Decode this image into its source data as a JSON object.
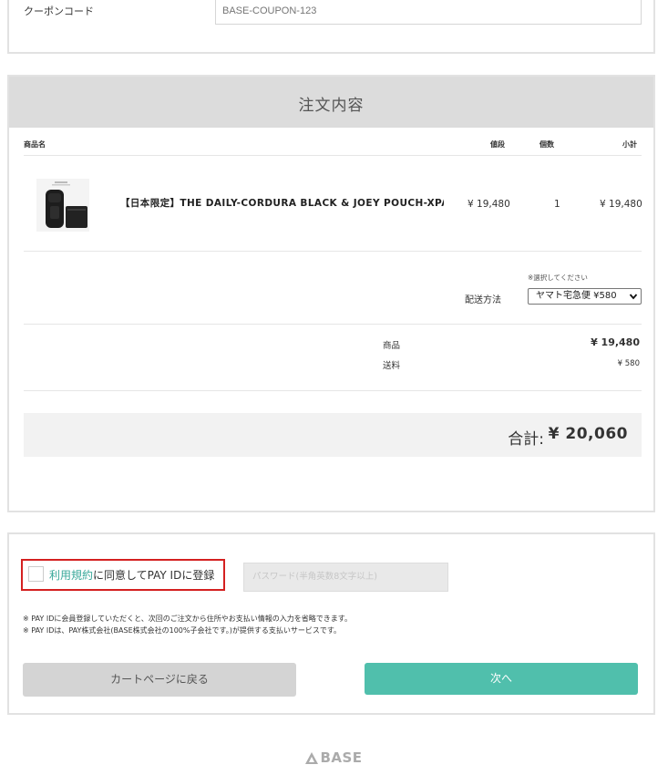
{
  "coupon": {
    "label": "クーポンコード",
    "placeholder": "BASE-COUPON-123"
  },
  "order": {
    "title": "注文内容",
    "columns": {
      "product": "商品名",
      "price": "値段",
      "qty": "個数",
      "subtotal": "小計"
    },
    "item": {
      "name": "【日本限定】THE DAILY-CORDURA BLACK & JOEY POUCH-XPAC",
      "price": "¥ 19,480",
      "qty": "1",
      "subtotal": "¥ 19,480"
    },
    "shipping": {
      "note": "※選択してください",
      "label": "配送方法",
      "selected": "ヤマト宅急便 ¥580"
    },
    "summary": {
      "items_label": "商品",
      "items_value": "¥ 19,480",
      "shipping_label": "送料",
      "shipping_value": "¥ 580"
    },
    "total": {
      "label": "合計:",
      "value": "¥ 20,060"
    }
  },
  "payid": {
    "terms_link": "利用規約",
    "agree_text": "に同意してPAY IDに登録",
    "password_placeholder": "パスワード(半角英数8文字以上)",
    "note1": "※ PAY IDに会員登録していただくと、次回のご注文から住所やお支払い情報の入力を省略できます。",
    "note2": "※ PAY IDは、PAY株式会社(BASE株式会社の100%子会社です。)が提供する支払いサービスです。",
    "back_button": "カートページに戻る",
    "next_button": "次へ",
    "next_color": "#50bfac"
  },
  "footer": {
    "logo_text": "BASE"
  }
}
